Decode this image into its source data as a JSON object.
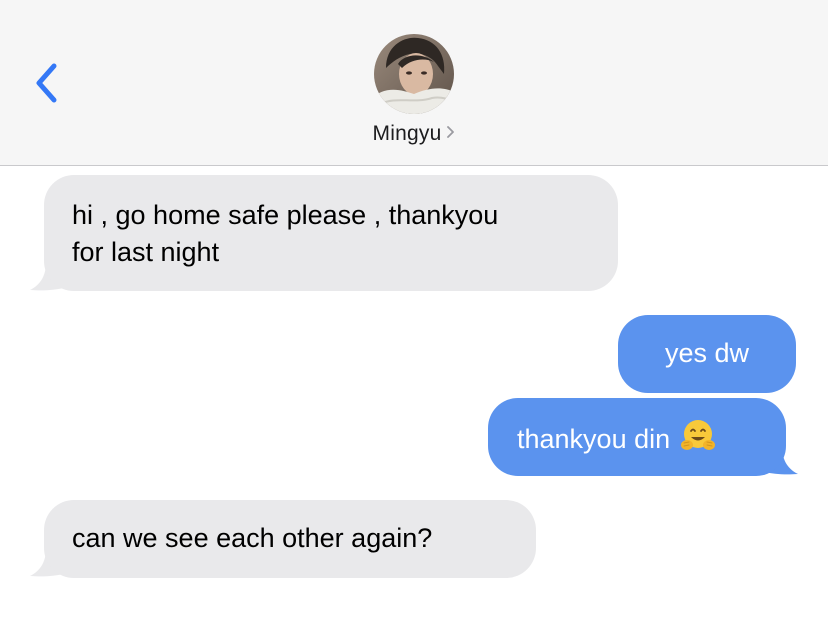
{
  "header": {
    "contact_name": "Mingyu",
    "back_icon": "chevron-left-icon",
    "details_icon": "chevron-right-icon"
  },
  "colors": {
    "header_bg": "#f6f6f6",
    "received_bubble": "#e9e9eb",
    "sent_bubble": "#5b93ee",
    "accent": "#3478f6"
  },
  "messages": [
    {
      "direction": "received",
      "lines": [
        "hi , go home safe please , thankyou",
        "for last night"
      ]
    },
    {
      "direction": "sent",
      "text": "yes dw"
    },
    {
      "direction": "sent",
      "text": "thankyou din",
      "emoji": "hugging-face-icon"
    },
    {
      "direction": "received",
      "text": "can we see each other again?"
    }
  ]
}
